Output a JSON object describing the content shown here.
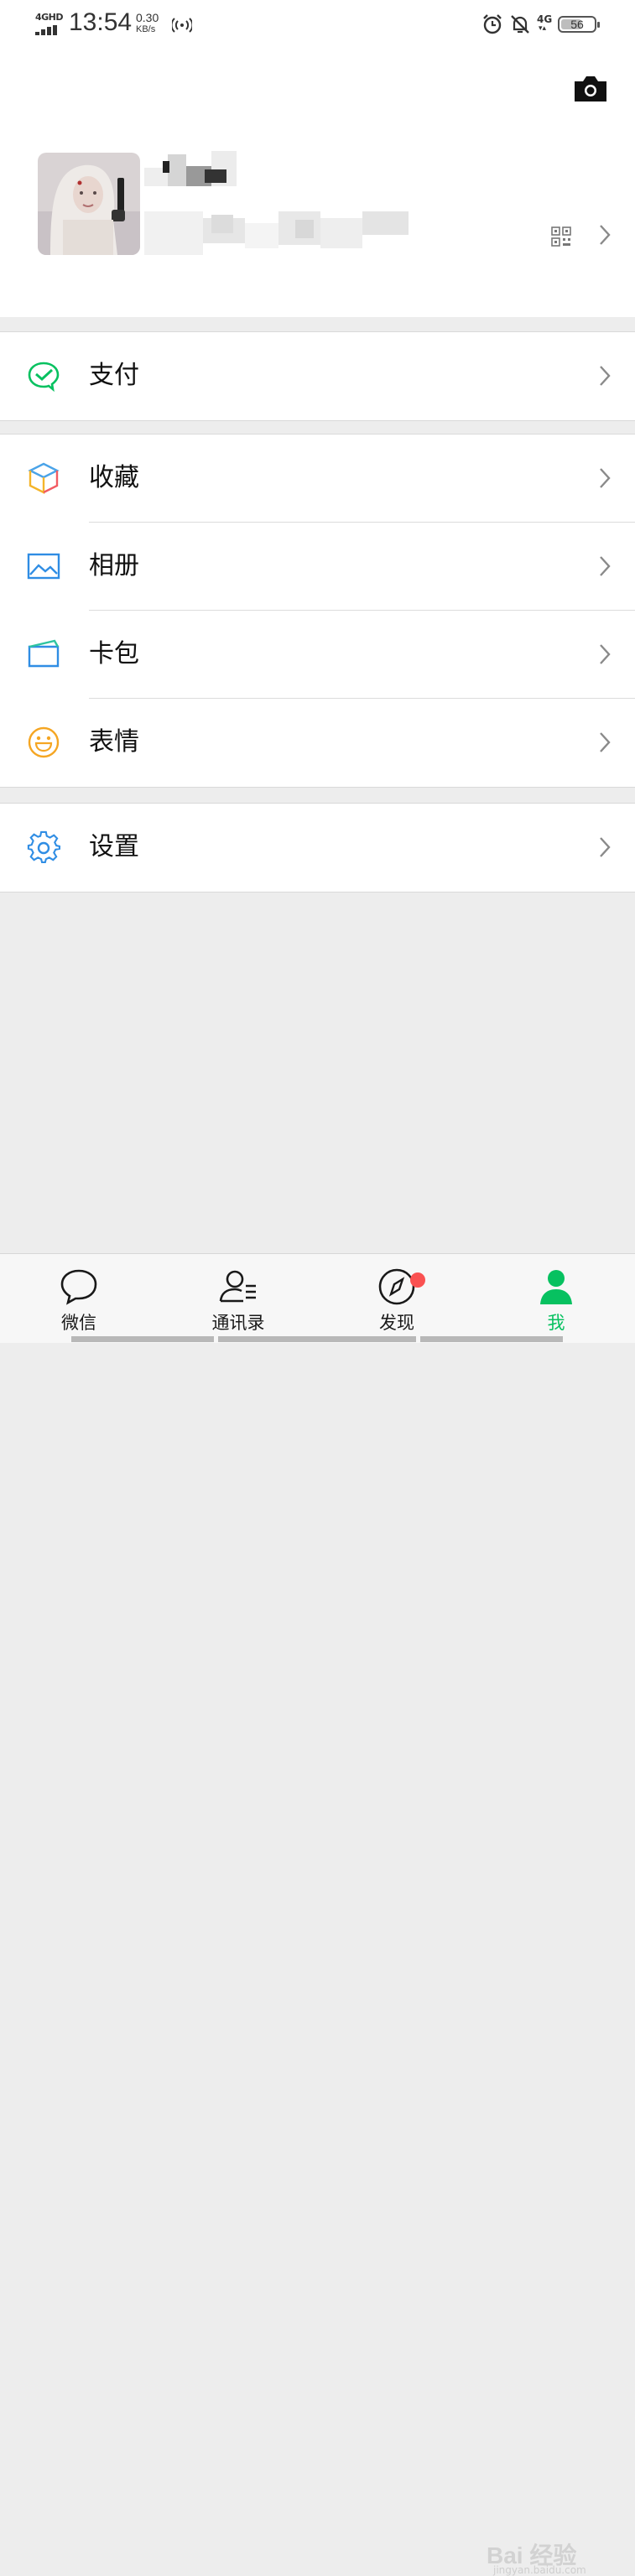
{
  "status_bar": {
    "network": "4GHD",
    "time": "13:54",
    "speed_value": "0.30",
    "speed_unit": "KB/s",
    "network_right": "4G",
    "battery": "56"
  },
  "profile": {
    "name": "",
    "wechat_id": ""
  },
  "menu": {
    "pay": "支付",
    "favorites": "收藏",
    "album": "相册",
    "cards": "卡包",
    "stickers": "表情",
    "settings": "设置"
  },
  "tabs": {
    "chats": "微信",
    "contacts": "通讯录",
    "discover": "发现",
    "me": "我"
  },
  "watermark": {
    "brand": "Bai 经验",
    "url": "jingyan.baidu.com"
  },
  "colors": {
    "accent": "#07c160",
    "badge": "#fa5151",
    "background": "#ededed"
  }
}
